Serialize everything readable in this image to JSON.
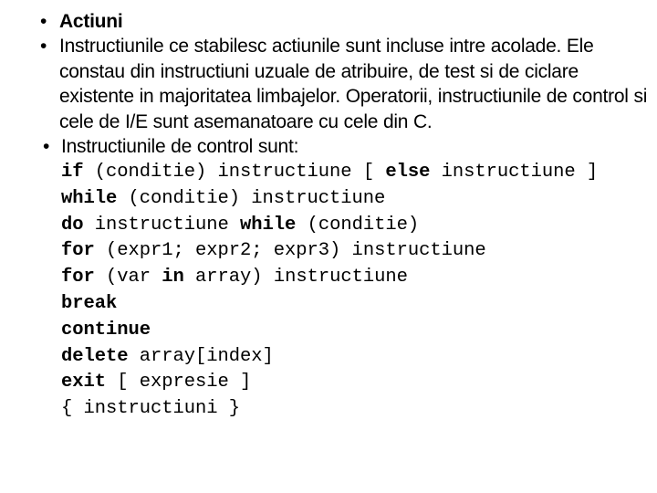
{
  "slide": {
    "bullets": [
      {
        "marker": "•",
        "text": "Actiuni",
        "bold": true
      },
      {
        "marker": "•",
        "text": "Instructiunile ce stabilesc actiunile sunt incluse intre acolade. Ele constau din instructiuni uzuale de atribuire, de test si de ciclare existente in majoritatea limbajelor. Operatorii, instructiunile de control si cele de I/E sunt asemanatoare cu cele din C.",
        "bold": false
      },
      {
        "marker": "•",
        "text": "Instructiunile de control sunt:",
        "bold": false
      }
    ],
    "code_lines": [
      [
        {
          "t": "if",
          "b": true
        },
        {
          "t": " (conditie) instructiune [ ",
          "b": false
        },
        {
          "t": "else",
          "b": true
        },
        {
          "t": " instructiune ]",
          "b": false
        }
      ],
      [
        {
          "t": "while",
          "b": true
        },
        {
          "t": " (conditie) instructiune",
          "b": false
        }
      ],
      [
        {
          "t": "do",
          "b": true
        },
        {
          "t": " instructiune ",
          "b": false
        },
        {
          "t": "while",
          "b": true
        },
        {
          "t": " (conditie)",
          "b": false
        }
      ],
      [
        {
          "t": "for",
          "b": true
        },
        {
          "t": " (expr1; expr2; expr3) instructiune",
          "b": false
        }
      ],
      [
        {
          "t": "for",
          "b": true
        },
        {
          "t": " (var ",
          "b": false
        },
        {
          "t": "in",
          "b": true
        },
        {
          "t": " array) instructiune",
          "b": false
        }
      ],
      [
        {
          "t": "break",
          "b": true
        }
      ],
      [
        {
          "t": "continue",
          "b": true
        }
      ],
      [
        {
          "t": "delete",
          "b": true
        },
        {
          "t": " array[index]",
          "b": false
        }
      ],
      [
        {
          "t": "exit",
          "b": true
        },
        {
          "t": " [ expresie ]",
          "b": false
        }
      ],
      [
        {
          "t": "{ instructiuni }",
          "b": false
        }
      ]
    ],
    "colors": {
      "background": "#ffffff",
      "text": "#000000"
    }
  }
}
